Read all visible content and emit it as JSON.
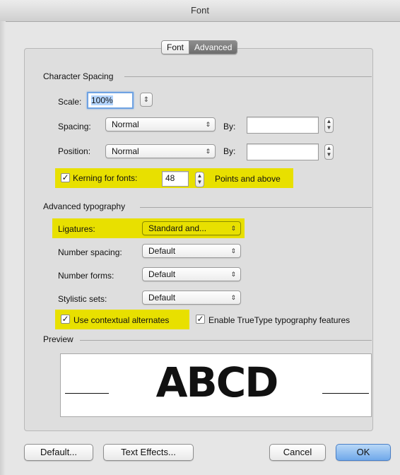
{
  "window": {
    "title": "Font"
  },
  "tabs": [
    {
      "label": "Font",
      "selected": false
    },
    {
      "label": "Advanced",
      "selected": true
    }
  ],
  "character_spacing": {
    "title": "Character Spacing",
    "scale": {
      "label": "Scale:",
      "value": "100%"
    },
    "spacing": {
      "label": "Spacing:",
      "value": "Normal",
      "by_label": "By:",
      "by_value": ""
    },
    "position": {
      "label": "Position:",
      "value": "Normal",
      "by_label": "By:",
      "by_value": ""
    },
    "kerning": {
      "label": "Kerning for fonts:",
      "checked": true,
      "value": "48",
      "suffix": "Points and above"
    }
  },
  "advanced_typography": {
    "title": "Advanced typography",
    "ligatures": {
      "label": "Ligatures:",
      "value": "Standard and..."
    },
    "number_spacing": {
      "label": "Number spacing:",
      "value": "Default"
    },
    "number_forms": {
      "label": "Number forms:",
      "value": "Default"
    },
    "stylistic_sets": {
      "label": "Stylistic sets:",
      "value": "Default"
    },
    "contextual_alternates": {
      "label": "Use contextual alternates",
      "checked": true
    },
    "truetype_features": {
      "label": "Enable TrueType typography features",
      "checked": true
    }
  },
  "preview": {
    "title": "Preview",
    "text": "ABCD"
  },
  "buttons": {
    "default": "Default...",
    "text_effects": "Text Effects...",
    "cancel": "Cancel",
    "ok": "OK"
  },
  "colors": {
    "highlight": "#e8e000",
    "primary_button": "#6fa8ea",
    "focus_ring": "#6fa3e3"
  },
  "icons": {
    "select_arrow": "updown-arrows-icon",
    "stepper": "stepper-icon",
    "check": "checkmark-icon"
  }
}
